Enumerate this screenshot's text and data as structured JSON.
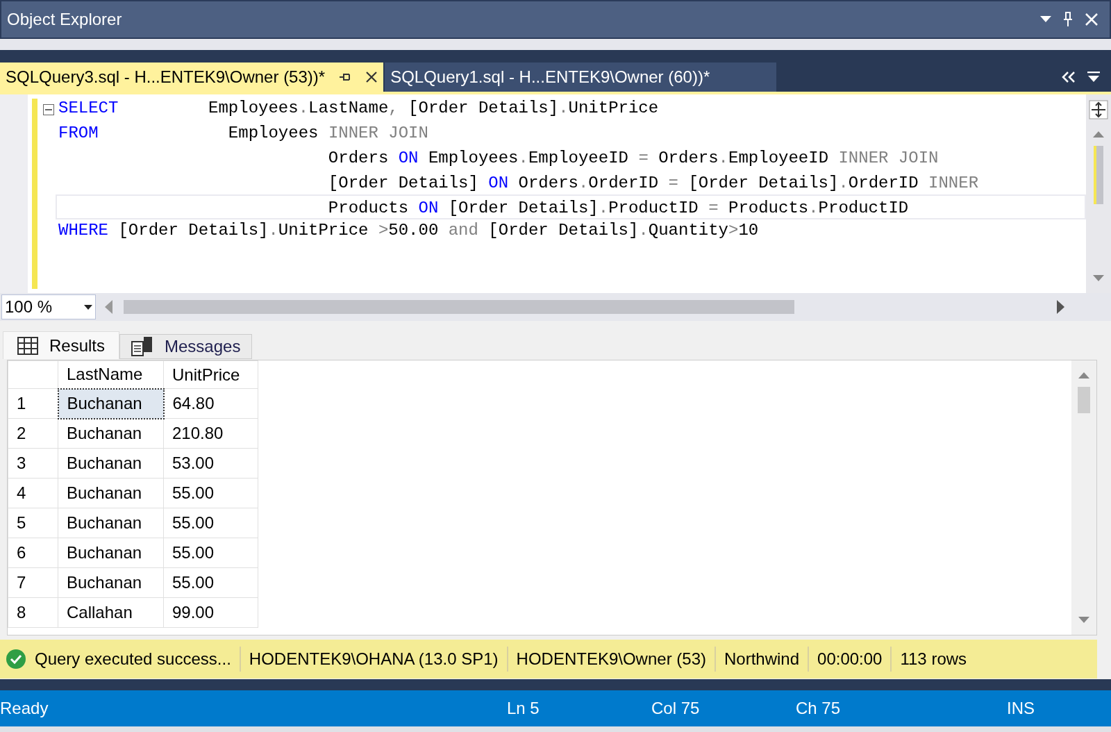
{
  "panel": {
    "title": "Object Explorer"
  },
  "doc_tabs": [
    {
      "label": "SQLQuery3.sql - H...ENTEK9\\Owner (53))*",
      "selected": true
    },
    {
      "label": "SQLQuery1.sql - H...ENTEK9\\Owner (60))*",
      "selected": false
    }
  ],
  "code_lines": [
    {
      "current": false,
      "tokens": [
        {
          "kind": "kw",
          "text": "SELECT"
        },
        {
          "kind": "id",
          "text": "         Employees"
        },
        {
          "kind": "op",
          "text": "."
        },
        {
          "kind": "id",
          "text": "LastName"
        },
        {
          "kind": "op",
          "text": ","
        },
        {
          "kind": "id",
          "text": " [Order Details]"
        },
        {
          "kind": "op",
          "text": "."
        },
        {
          "kind": "id",
          "text": "UnitPrice"
        }
      ]
    },
    {
      "current": false,
      "tokens": [
        {
          "kind": "kw",
          "text": "FROM"
        },
        {
          "kind": "id",
          "text": "             Employees "
        },
        {
          "kind": "op",
          "text": "INNER JOIN"
        }
      ]
    },
    {
      "current": false,
      "tokens": [
        {
          "kind": "id",
          "text": "                           Orders "
        },
        {
          "kind": "kw",
          "text": "ON"
        },
        {
          "kind": "id",
          "text": " Employees"
        },
        {
          "kind": "op",
          "text": "."
        },
        {
          "kind": "id",
          "text": "EmployeeID "
        },
        {
          "kind": "op",
          "text": "="
        },
        {
          "kind": "id",
          "text": " Orders"
        },
        {
          "kind": "op",
          "text": "."
        },
        {
          "kind": "id",
          "text": "EmployeeID "
        },
        {
          "kind": "op",
          "text": "INNER JOIN"
        }
      ]
    },
    {
      "current": false,
      "tokens": [
        {
          "kind": "id",
          "text": "                           [Order Details] "
        },
        {
          "kind": "kw",
          "text": "ON"
        },
        {
          "kind": "id",
          "text": " Orders"
        },
        {
          "kind": "op",
          "text": "."
        },
        {
          "kind": "id",
          "text": "OrderID "
        },
        {
          "kind": "op",
          "text": "="
        },
        {
          "kind": "id",
          "text": " [Order Details]"
        },
        {
          "kind": "op",
          "text": "."
        },
        {
          "kind": "id",
          "text": "OrderID "
        },
        {
          "kind": "op",
          "text": "INNER"
        }
      ]
    },
    {
      "current": true,
      "tokens": [
        {
          "kind": "id",
          "text": "                           Products "
        },
        {
          "kind": "kw",
          "text": "ON"
        },
        {
          "kind": "id",
          "text": " [Order Details]"
        },
        {
          "kind": "op",
          "text": "."
        },
        {
          "kind": "id",
          "text": "ProductID "
        },
        {
          "kind": "op",
          "text": "="
        },
        {
          "kind": "id",
          "text": " Products"
        },
        {
          "kind": "op",
          "text": "."
        },
        {
          "kind": "id",
          "text": "ProductID"
        }
      ]
    },
    {
      "current": false,
      "tokens": [
        {
          "kind": "kw",
          "text": "WHERE"
        },
        {
          "kind": "id",
          "text": " [Order Details]"
        },
        {
          "kind": "op",
          "text": "."
        },
        {
          "kind": "id",
          "text": "UnitPrice "
        },
        {
          "kind": "op",
          "text": ">"
        },
        {
          "kind": "id",
          "text": "50.00 "
        },
        {
          "kind": "op",
          "text": "and"
        },
        {
          "kind": "id",
          "text": " [Order Details]"
        },
        {
          "kind": "op",
          "text": "."
        },
        {
          "kind": "id",
          "text": "Quantity"
        },
        {
          "kind": "op",
          "text": ">"
        },
        {
          "kind": "id",
          "text": "10"
        }
      ]
    }
  ],
  "zoom": "100 %",
  "result_tabs": [
    {
      "label": "Results",
      "selected": true
    },
    {
      "label": "Messages",
      "selected": false
    }
  ],
  "table": {
    "columns": [
      "LastName",
      "UnitPrice"
    ],
    "rows": [
      {
        "number": "1",
        "cells": [
          "Buchanan",
          "64.80"
        ],
        "selected": true
      },
      {
        "number": "2",
        "cells": [
          "Buchanan",
          "210.80"
        ],
        "selected": false
      },
      {
        "number": "3",
        "cells": [
          "Buchanan",
          "53.00"
        ],
        "selected": false
      },
      {
        "number": "4",
        "cells": [
          "Buchanan",
          "55.00"
        ],
        "selected": false
      },
      {
        "number": "5",
        "cells": [
          "Buchanan",
          "55.00"
        ],
        "selected": false
      },
      {
        "number": "6",
        "cells": [
          "Buchanan",
          "55.00"
        ],
        "selected": false
      },
      {
        "number": "7",
        "cells": [
          "Buchanan",
          "55.00"
        ],
        "selected": false
      },
      {
        "number": "8",
        "cells": [
          "Callahan",
          "99.00"
        ],
        "selected": false
      }
    ]
  },
  "query_status": [
    "Query executed success...",
    "HODENTEK9\\OHANA (13.0 SP1)",
    "HODENTEK9\\Owner (53)",
    "Northwind",
    "00:00:00",
    "113 rows"
  ],
  "status_bar": {
    "state": "Ready",
    "line": "Ln 5",
    "column": "Col 75",
    "char": "Ch 75",
    "mode": "INS"
  }
}
